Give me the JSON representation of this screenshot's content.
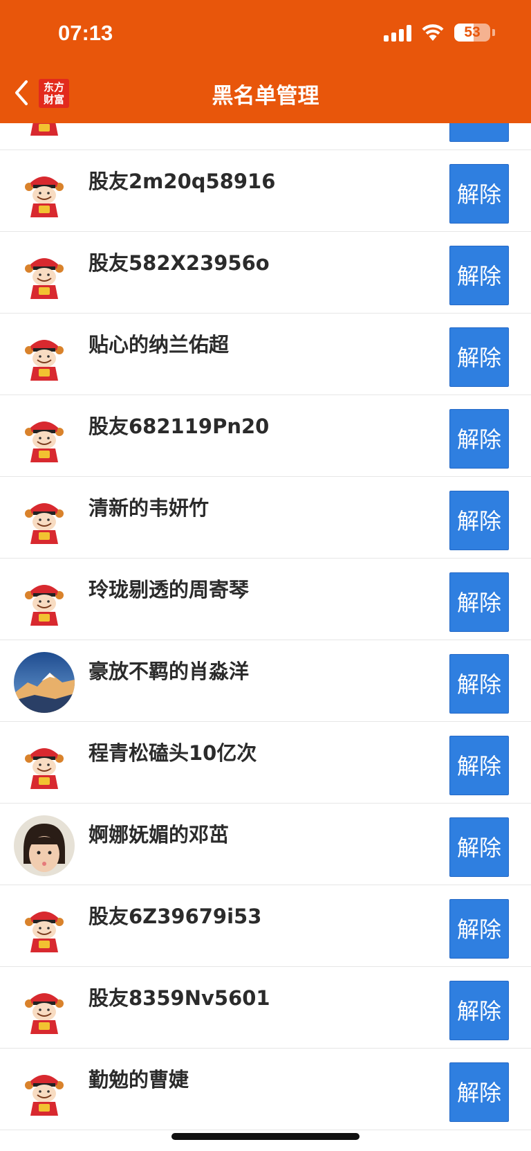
{
  "status_bar": {
    "time": "07:13",
    "battery": "53",
    "battery_level": 0.53
  },
  "header": {
    "title": "黑名单管理",
    "logo_line1": "东方",
    "logo_line2": "财富"
  },
  "colors": {
    "header": "#e8560b",
    "button": "#2f7fe0"
  },
  "blocked_users": [
    {
      "name": "",
      "avatar": "cartoon-god-of-wealth",
      "action": "解除"
    },
    {
      "name": "股友2m20q58916",
      "avatar": "cartoon-god-of-wealth",
      "action": "解除"
    },
    {
      "name": "股友582X23956o",
      "avatar": "cartoon-god-of-wealth",
      "action": "解除"
    },
    {
      "name": "贴心的纳兰佑超",
      "avatar": "cartoon-god-of-wealth",
      "action": "解除"
    },
    {
      "name": "股友682119Pn20",
      "avatar": "cartoon-god-of-wealth",
      "action": "解除"
    },
    {
      "name": "清新的韦妍竹",
      "avatar": "cartoon-god-of-wealth",
      "action": "解除"
    },
    {
      "name": "玲珑剔透的周寄琴",
      "avatar": "cartoon-god-of-wealth",
      "action": "解除"
    },
    {
      "name": "豪放不羁的肖淼洋",
      "avatar": "mountain-photo",
      "action": "解除"
    },
    {
      "name": "程青松磕头10亿次",
      "avatar": "cartoon-god-of-wealth",
      "action": "解除"
    },
    {
      "name": "婀娜妩媚的邓茁",
      "avatar": "child-photo",
      "action": "解除"
    },
    {
      "name": "股友6Z39679i53",
      "avatar": "cartoon-god-of-wealth",
      "action": "解除"
    },
    {
      "name": "股友8359Nv5601",
      "avatar": "cartoon-god-of-wealth",
      "action": "解除"
    },
    {
      "name": "勤勉的曹婕",
      "avatar": "cartoon-god-of-wealth",
      "action": "解除"
    }
  ]
}
